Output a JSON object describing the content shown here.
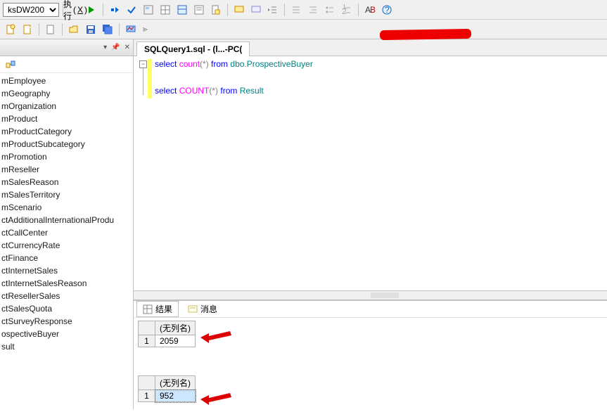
{
  "toolbar": {
    "db_selected": "ksDW200",
    "execute_label": "执行",
    "execute_hotkey": "X"
  },
  "sidebar": {
    "items": [
      "mEmployee",
      "mGeography",
      "mOrganization",
      "mProduct",
      "mProductCategory",
      "mProductSubcategory",
      "mPromotion",
      "mReseller",
      "mSalesReason",
      "mSalesTerritory",
      "mScenario",
      "ctAdditionalInternationalProdu",
      "ctCallCenter",
      "ctCurrencyRate",
      "ctFinance",
      "ctInternetSales",
      "ctInternetSalesReason",
      "ctResellerSales",
      "ctSalesQuota",
      "ctSurveyResponse",
      "ospectiveBuyer",
      "sult"
    ]
  },
  "document": {
    "tab_title": "SQLQuery1.sql - (l...-PC(",
    "lines": [
      {
        "tokens": [
          {
            "t": "select ",
            "c": "kw-blue"
          },
          {
            "t": "count",
            "c": "kw-mag"
          },
          {
            "t": "(*) ",
            "c": "kw-gray"
          },
          {
            "t": "from ",
            "c": "kw-blue"
          },
          {
            "t": "dbo",
            "c": "kw-teal"
          },
          {
            "t": ".",
            "c": "kw-gray"
          },
          {
            "t": "ProspectiveBuyer",
            "c": "kw-teal"
          }
        ]
      },
      {
        "tokens": []
      },
      {
        "tokens": [
          {
            "t": "select ",
            "c": "kw-blue"
          },
          {
            "t": "COUNT",
            "c": "kw-mag"
          },
          {
            "t": "(*) ",
            "c": "kw-gray"
          },
          {
            "t": "from ",
            "c": "kw-blue"
          },
          {
            "t": "Result",
            "c": "kw-teal"
          }
        ]
      }
    ]
  },
  "results": {
    "tab_results": "结果",
    "tab_messages": "消息",
    "grids": [
      {
        "header": "(无列名)",
        "row_index": "1",
        "value": "2059",
        "selected": false
      },
      {
        "header": "(无列名)",
        "row_index": "1",
        "value": "952",
        "selected": true
      }
    ]
  }
}
